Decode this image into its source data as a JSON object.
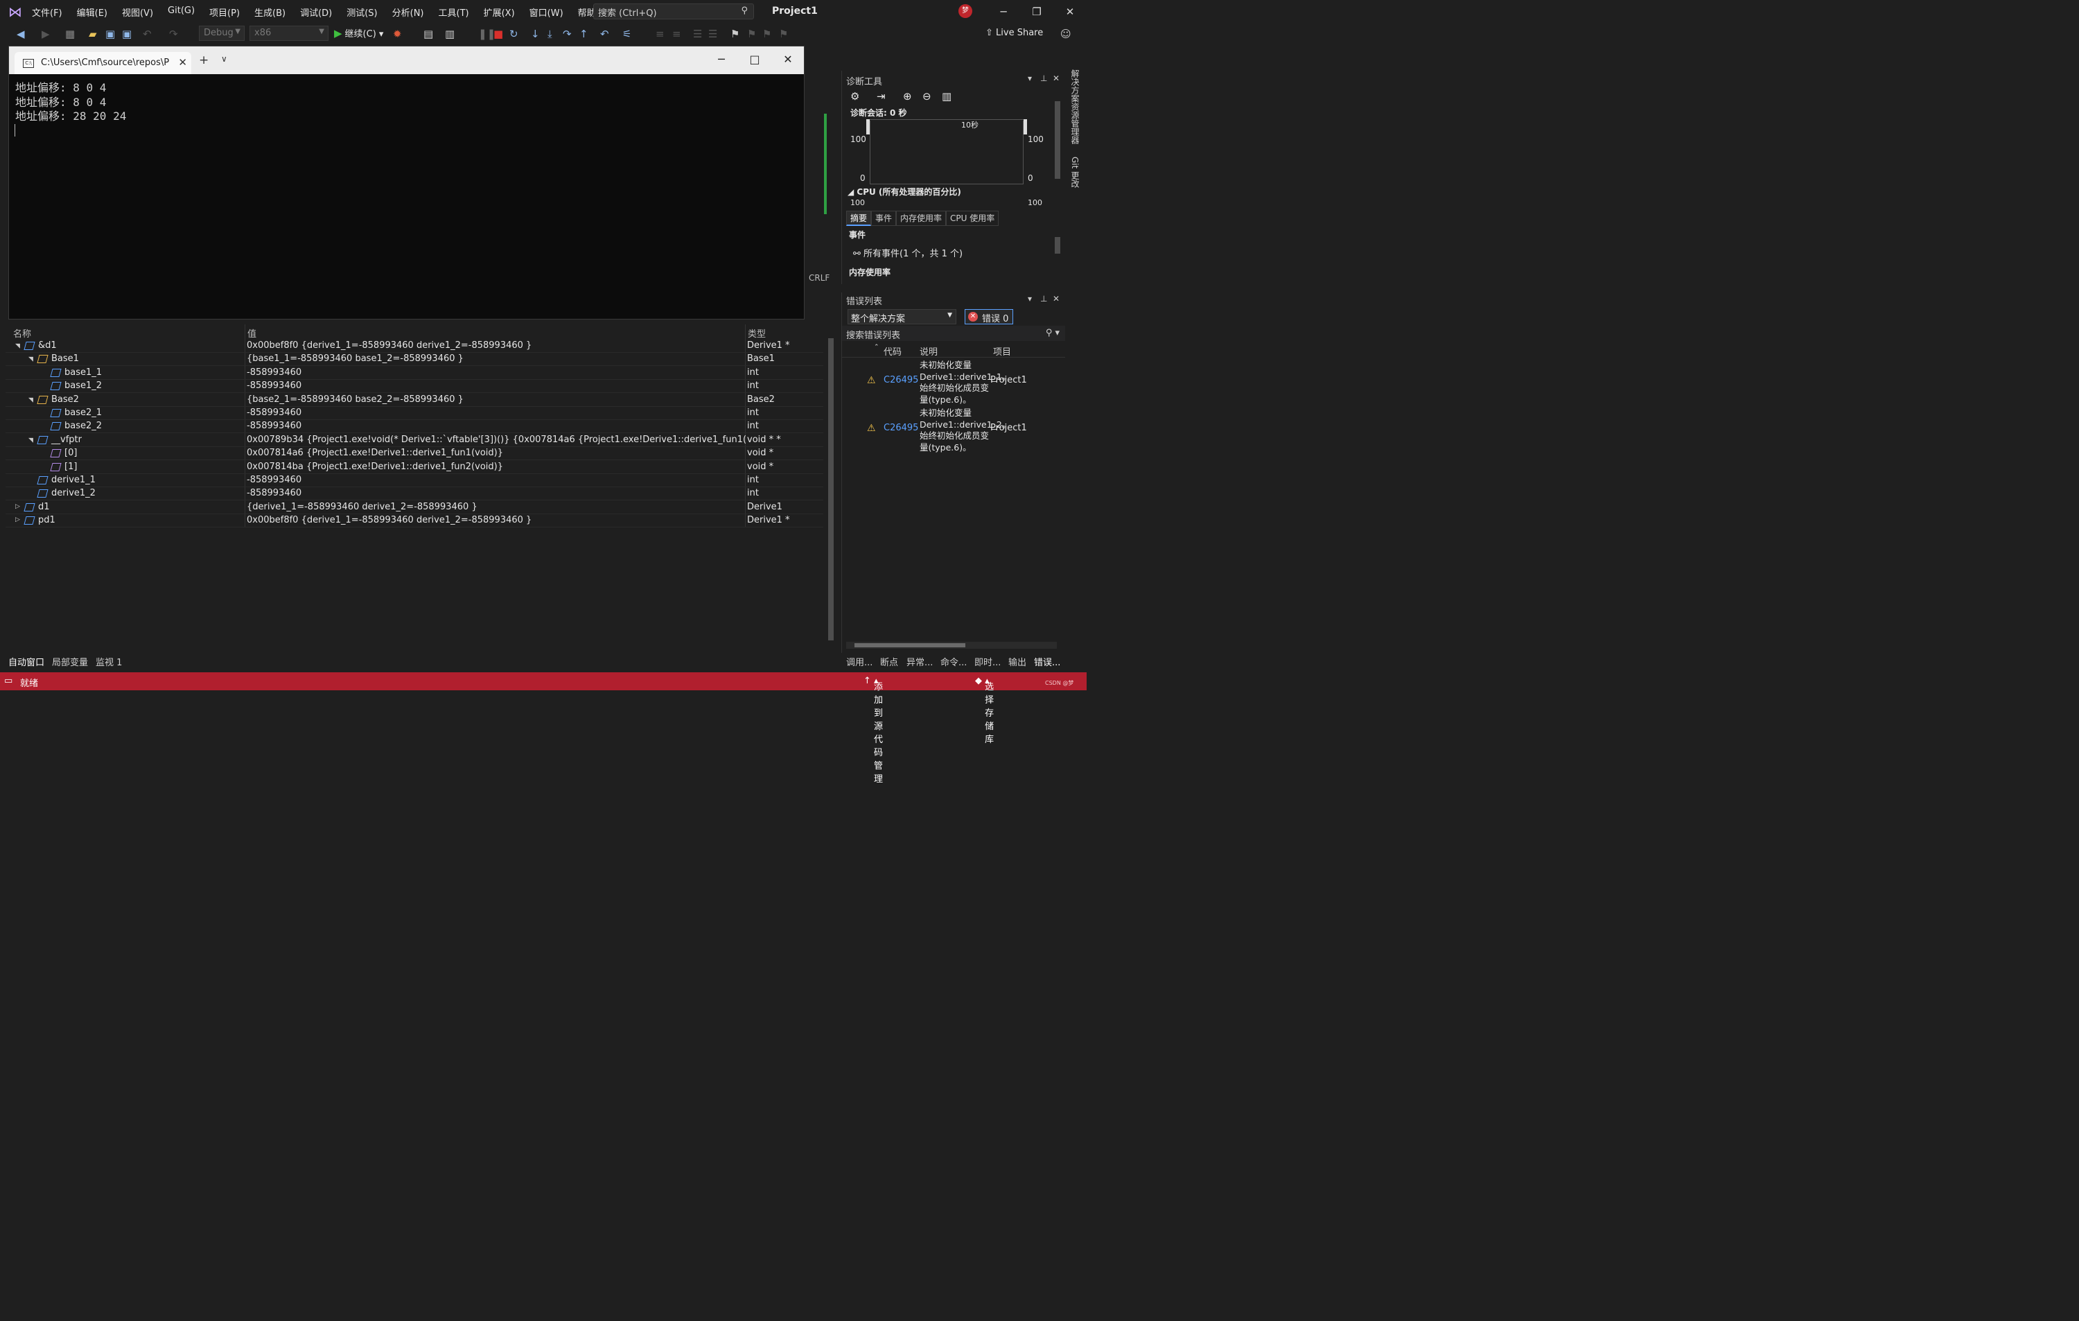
{
  "menubar": {
    "items": [
      "文件(F)",
      "编辑(E)",
      "视图(V)",
      "Git(G)",
      "项目(P)",
      "生成(B)",
      "调试(D)",
      "测试(S)",
      "分析(N)",
      "工具(T)",
      "扩展(X)",
      "窗口(W)",
      "帮助(H)"
    ],
    "search_placeholder": "搜索 (Ctrl+Q)",
    "project": "Project1",
    "avatar": "梦"
  },
  "toolbar": {
    "config": "Debug",
    "platform": "x86",
    "continue": "继续(C)",
    "live_share": "Live Share"
  },
  "console": {
    "tab_title": "C:\\Users\\Cmf\\source\\repos\\P",
    "lines": [
      "地址偏移: 8 0 4",
      "地址偏移: 8 0 4",
      "地址偏移: 28 20 24"
    ]
  },
  "side": {
    "crlf": "CRLF",
    "vertical_tabs": [
      "解决方案资源管理器",
      "Git 更改"
    ]
  },
  "diag": {
    "title": "诊断工具",
    "session": "诊断会话: 0 秒",
    "time_label": "10秒",
    "y_max": "100",
    "y_min": "0",
    "cpu_label": "CPU (所有处理器的百分比)",
    "cpu_next": "100",
    "tabs": [
      "摘要",
      "事件",
      "内存使用率",
      "CPU 使用率"
    ],
    "events_header": "事件",
    "all_events": "所有事件(1 个，共 1 个)",
    "memory_header": "内存使用率"
  },
  "errors": {
    "title": "错误列表",
    "scope": "整个解决方案",
    "error_btn": "错误 0",
    "search": "搜索错误列表",
    "cols": [
      "代码",
      "说明",
      "项目"
    ],
    "rows": [
      {
        "code": "C26495",
        "desc": "未初始化变量 Derive1::derive1_1。始终初始化成员变量(type.6)。",
        "project": "Project1"
      },
      {
        "code": "C26495",
        "desc": "未初始化变量 Derive1::derive1_2。始终初始化成员变量(type.6)。",
        "project": "Project1"
      }
    ]
  },
  "autos": {
    "headers": [
      "名称",
      "值",
      "类型"
    ],
    "rows": [
      {
        "name": "&d1",
        "value": "0x00bef8f0 {derive1_1=-858993460 derive1_2=-858993460 }",
        "type": "Derive1 *"
      },
      {
        "name": "Base1",
        "value": "{base1_1=-858993460 base1_2=-858993460 }",
        "type": "Base1"
      },
      {
        "name": "base1_1",
        "value": "-858993460",
        "type": "int"
      },
      {
        "name": "base1_2",
        "value": "-858993460",
        "type": "int"
      },
      {
        "name": "Base2",
        "value": "{base2_1=-858993460 base2_2=-858993460 }",
        "type": "Base2"
      },
      {
        "name": "base2_1",
        "value": "-858993460",
        "type": "int"
      },
      {
        "name": "base2_2",
        "value": "-858993460",
        "type": "int"
      },
      {
        "name": "__vfptr",
        "value": "0x00789b34 {Project1.exe!void(* Derive1::`vftable'[3])()} {0x007814a6 {Project1.exe!Derive1::derive1_fun1(void)}, ...}",
        "type": "void * *"
      },
      {
        "name": "[0]",
        "value": "0x007814a6 {Project1.exe!Derive1::derive1_fun1(void)}",
        "type": "void *"
      },
      {
        "name": "[1]",
        "value": "0x007814ba {Project1.exe!Derive1::derive1_fun2(void)}",
        "type": "void *"
      },
      {
        "name": "derive1_1",
        "value": "-858993460",
        "type": "int"
      },
      {
        "name": "derive1_2",
        "value": "-858993460",
        "type": "int"
      },
      {
        "name": "d1",
        "value": "{derive1_1=-858993460 derive1_2=-858993460 }",
        "type": "Derive1"
      },
      {
        "name": "pd1",
        "value": "0x00bef8f0 {derive1_1=-858993460 derive1_2=-858993460 }",
        "type": "Derive1 *"
      }
    ]
  },
  "bottom_tabs": [
    "自动窗口",
    "局部变量",
    "监视 1"
  ],
  "right_tabs": [
    "调用...",
    "断点",
    "异常...",
    "命令...",
    "即时...",
    "输出",
    "错误..."
  ],
  "status": {
    "ready": "就绪",
    "add_source": "添加到源代码管理",
    "select_repo": "选择存储库",
    "watermark": "CSDN @梦"
  },
  "colors": {
    "accent": "#5aa0ff",
    "status_bar": "#b11f2e",
    "warning": "#f2c34b",
    "stop": "#d9302c",
    "play": "#3fbf3f"
  }
}
